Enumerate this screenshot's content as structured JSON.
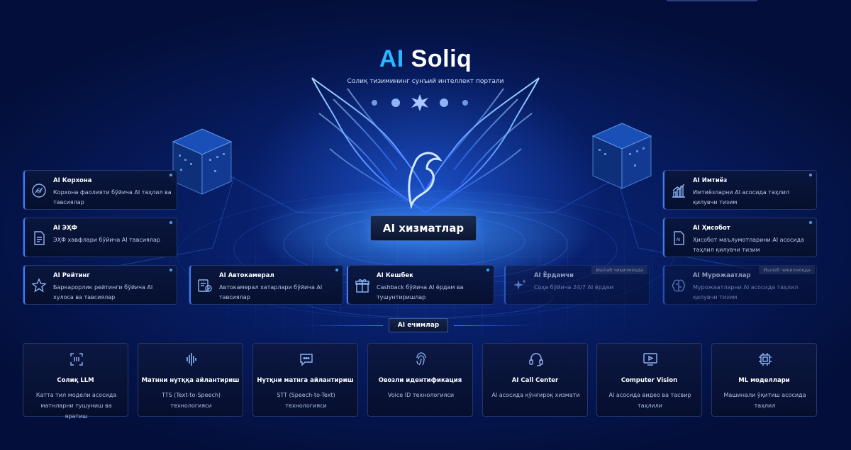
{
  "header": {
    "logo_ai": "AI",
    "logo_name": "Soliq",
    "subtitle": "Солиқ тизимининг сунъий интеллект портали"
  },
  "center_label": "AI хизматлар",
  "services_left": [
    {
      "title": "AI Корхона",
      "desc": "Корхона фаолияти бўйича AI таҳлил ва тавсиялар",
      "icon": "company-analytics-icon"
    },
    {
      "title": "AI ЭҲФ",
      "desc": "ЭҲФ хавфлари бўйича AI тавсиялар",
      "icon": "document-icon"
    },
    {
      "title": "AI Рейтинг",
      "desc": "Баркарорлик рейтинги бўйича AI хулоса ва тавсиялар",
      "icon": "star-icon"
    }
  ],
  "services_right": [
    {
      "title": "AI Имтиёз",
      "desc": "Имтиёзларни AI асосида таҳлил қилувчи тизим",
      "icon": "bar-chart-icon"
    },
    {
      "title": "AI Ҳисобот",
      "desc": "Ҳисобот маълумотларини AI асосида таҳлил қилувчи тизим",
      "icon": "ai-report-icon"
    },
    {
      "title": "AI Мурожаатлар",
      "desc": "Мурожаатларни AI асосида таҳлил қилувчи тизим",
      "icon": "brain-icon",
      "badge": "Ишлаб чиқилмоқда"
    }
  ],
  "services_middle": [
    {
      "title": "AI Автокамерал",
      "desc": "Автокамерал хатарлари бўйича AI тавсиялар",
      "icon": "camera-check-icon"
    },
    {
      "title": "AI Кешбек",
      "desc": "Cashback бўйича AI ёрдам ва тушунтиришлар",
      "icon": "gift-icon"
    },
    {
      "title": "AI Ёрдамчи",
      "desc": "Соҳа бўйича 24/7 AI ёрдам",
      "icon": "sparkle-icon",
      "badge": "Ишлаб чиқилмоқда"
    }
  ],
  "tools_section": "AI ечимлар",
  "tools": [
    {
      "title": "Солиқ LLM",
      "desc": "Катта тил модели асосида матнларни тушуниш ва яратиш",
      "icon": "llm-icon"
    },
    {
      "title": "Матнни нутққа айлантириш",
      "desc": "TTS (Text-to-Speech) технологияси",
      "icon": "waveform-icon"
    },
    {
      "title": "Нутқни матнга айлантириш",
      "desc": "STT (Speech-to-Text) технологияси",
      "icon": "chat-bubble-icon"
    },
    {
      "title": "Овозли идентификация",
      "desc": "Voice ID технологияси",
      "icon": "fingerprint-icon"
    },
    {
      "title": "AI Call Center",
      "desc": "AI асосида қўнғироқ хизмати",
      "icon": "headset-icon"
    },
    {
      "title": "Computer Vision",
      "desc": "AI асосида видео ва тасвир таҳлили",
      "icon": "video-play-icon"
    },
    {
      "title": "ML моделлари",
      "desc": "Машинали ўқитиш асосида таҳлил",
      "icon": "chip-icon"
    }
  ]
}
